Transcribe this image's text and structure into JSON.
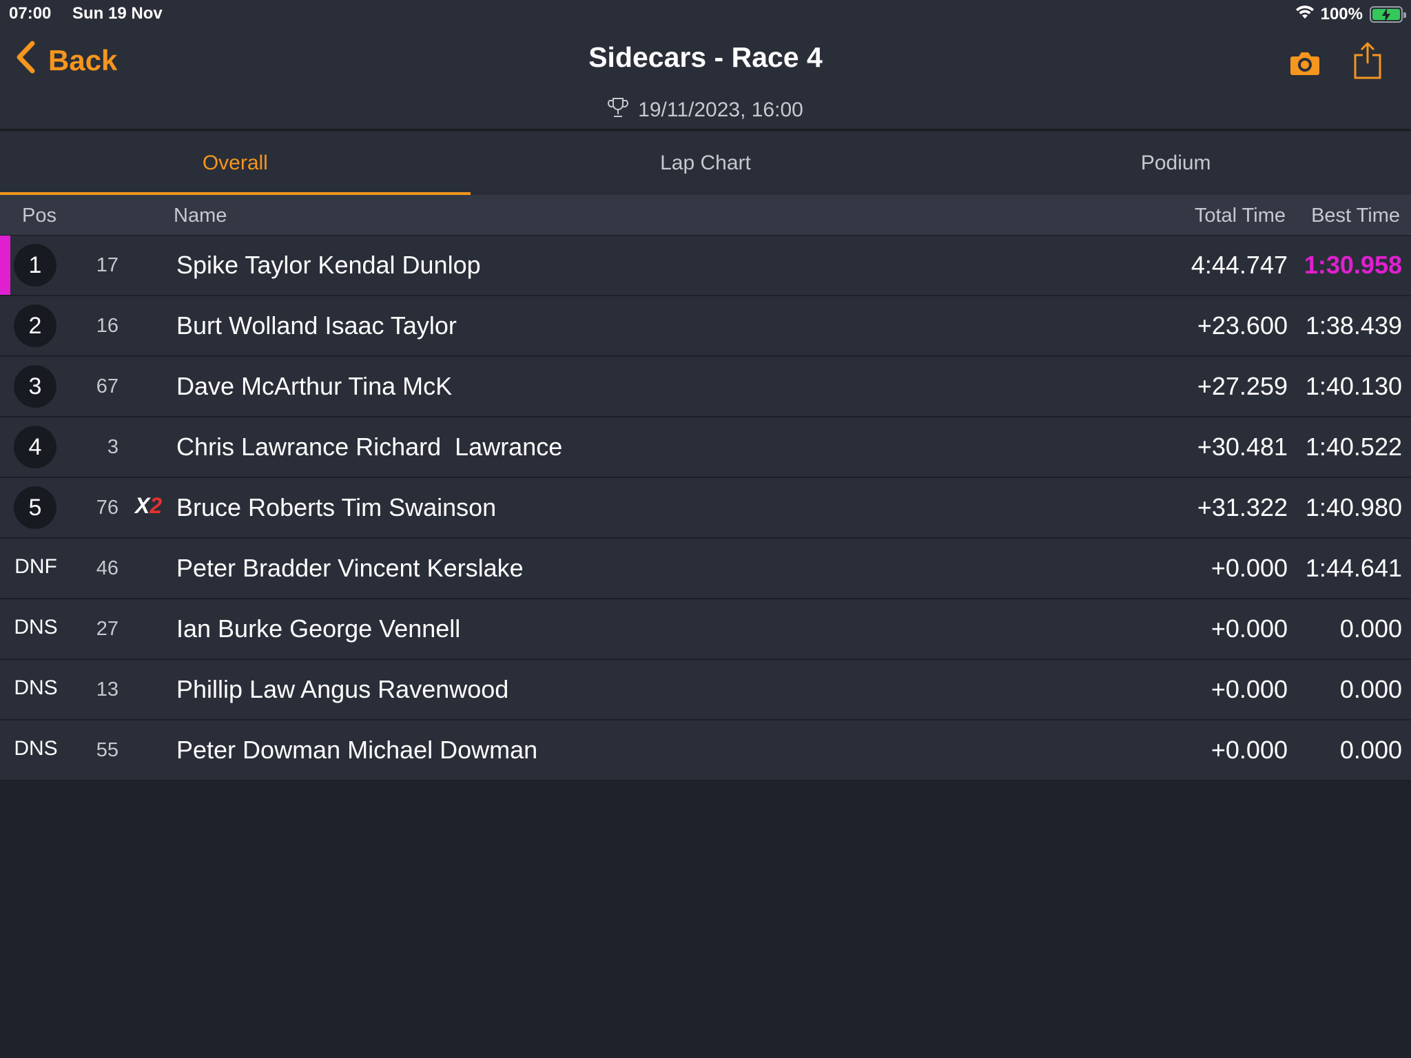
{
  "status": {
    "time": "07:00",
    "date": "Sun 19 Nov",
    "battery": "100%"
  },
  "nav": {
    "back": "Back",
    "title": "Sidecars - Race 4",
    "datetime": "19/11/2023, 16:00"
  },
  "tabs": [
    "Overall",
    "Lap Chart",
    "Podium"
  ],
  "active_tab": 0,
  "columns": {
    "pos": "Pos",
    "name": "Name",
    "total": "Total Time",
    "best": "Best Time"
  },
  "colors": {
    "accent": "#f5961e",
    "fastest": "#e020d0",
    "badge_red": "#e5312f"
  },
  "results": [
    {
      "pos": "1",
      "num": "17",
      "badge": "",
      "name": "Spike Taylor Kendal Dunlop",
      "total": "4:44.747",
      "best": "1:30.958",
      "fastest": true
    },
    {
      "pos": "2",
      "num": "16",
      "badge": "",
      "name": "Burt Wolland Isaac Taylor",
      "total": "+23.600",
      "best": "1:38.439"
    },
    {
      "pos": "3",
      "num": "67",
      "badge": "",
      "name": "Dave McArthur Tina McK",
      "total": "+27.259",
      "best": "1:40.130"
    },
    {
      "pos": "4",
      "num": "3",
      "badge": "",
      "name": "Chris Lawrance Richard  Lawrance",
      "total": "+30.481",
      "best": "1:40.522"
    },
    {
      "pos": "5",
      "num": "76",
      "badge": "X2",
      "name": "Bruce Roberts Tim Swainson",
      "total": "+31.322",
      "best": "1:40.980"
    },
    {
      "pos": "DNF",
      "num": "46",
      "badge": "",
      "name": "Peter Bradder Vincent Kerslake",
      "total": "+0.000",
      "best": "1:44.641"
    },
    {
      "pos": "DNS",
      "num": "27",
      "badge": "",
      "name": "Ian Burke George Vennell",
      "total": "+0.000",
      "best": "0.000"
    },
    {
      "pos": "DNS",
      "num": "13",
      "badge": "",
      "name": "Phillip Law Angus Ravenwood",
      "total": "+0.000",
      "best": "0.000"
    },
    {
      "pos": "DNS",
      "num": "55",
      "badge": "",
      "name": "Peter Dowman Michael Dowman",
      "total": "+0.000",
      "best": "0.000"
    }
  ]
}
